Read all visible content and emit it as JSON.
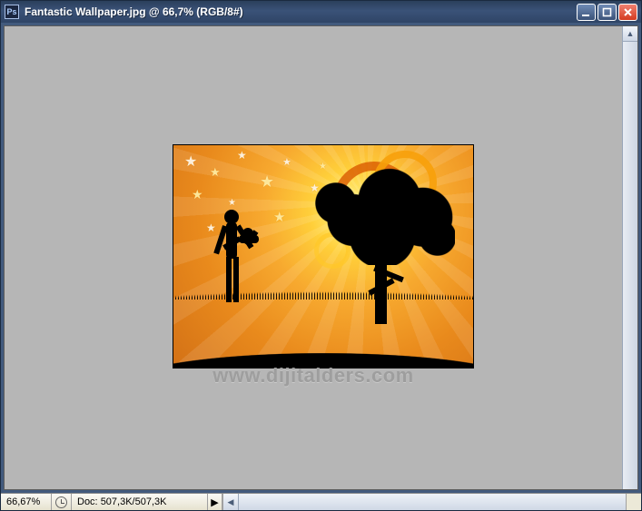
{
  "title": "Fantastic Wallpaper.jpg @ 66,7% (RGB/8#)",
  "app_icon_label": "Ps",
  "status": {
    "zoom": "66,67%",
    "doc_label": "Doc:",
    "doc_value": "507,3K/507,3K"
  },
  "watermark": "www.dijitalders.com"
}
